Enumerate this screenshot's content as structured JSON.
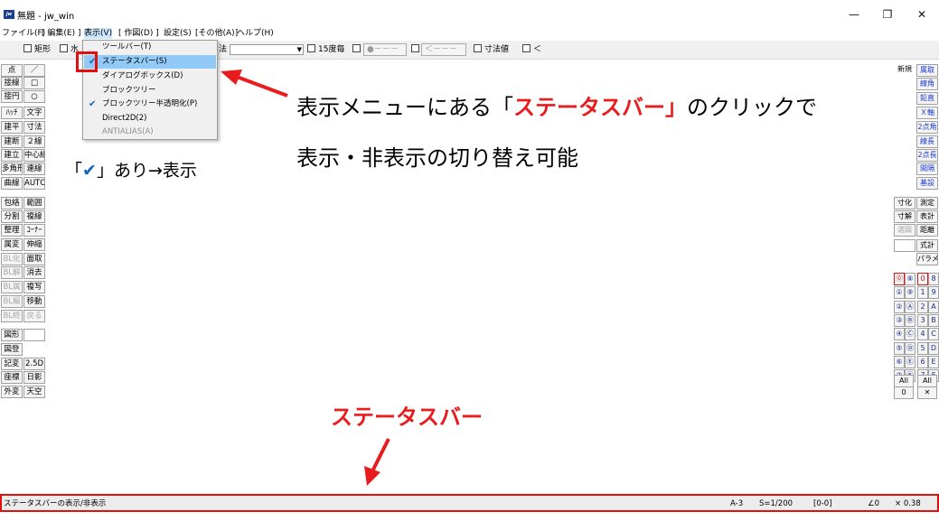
{
  "window": {
    "app_icon": "jw",
    "title": "無題 - jw_win",
    "minimize": "—",
    "maximize": "❐",
    "close": "✕"
  },
  "menu": {
    "items": [
      "ファイル(F)",
      "[ 編集(E) ]",
      "表示(V)",
      "[ 作図(D) ]",
      "設定(S)",
      "[その他(A)]",
      "ヘルプ(H)"
    ]
  },
  "toolbar": {
    "rect": "矩形",
    "horiz": "水",
    "dim_partial": "法",
    "angle15": "15度毎",
    "field1": "●－－－",
    "field2": "＜－－－",
    "dim_value": "寸法値",
    "last": "＜"
  },
  "dropdown": {
    "items": [
      {
        "label": "ツールバー(T)",
        "checked": false
      },
      {
        "label": "ステータスバー(S)",
        "checked": true
      },
      {
        "label": "ダイアログボックス(D)",
        "checked": false
      },
      {
        "label": "ブロックツリー",
        "checked": false
      },
      {
        "label": "ブロックツリー半透明化(P)",
        "checked": true
      },
      {
        "label": "Direct2D(2)",
        "checked": false
      },
      {
        "label": "ANTIALIAS(A)",
        "checked": false
      }
    ],
    "check_glyph": "✔"
  },
  "left_toolbar": [
    [
      "点",
      "／"
    ],
    [
      "接線",
      "□"
    ],
    [
      "接円",
      "○"
    ],
    [
      "ﾊｯﾁ",
      "文字"
    ],
    [
      "建平",
      "寸法"
    ],
    [
      "建断",
      "２線"
    ],
    [
      "建立",
      "中心線"
    ],
    [
      "多角形",
      "連線"
    ],
    [
      "曲線",
      "AUTO"
    ],
    [
      "包絡",
      "範囲"
    ],
    [
      "分割",
      "複線"
    ],
    [
      "整理",
      "ｺｰﾅｰ"
    ],
    [
      "属変",
      "伸縮"
    ],
    [
      "BL化",
      "面取"
    ],
    [
      "BL解",
      "消去"
    ],
    [
      "BL属",
      "複写"
    ],
    [
      "BL編",
      "移動"
    ],
    [
      "BL終",
      "戻る"
    ],
    [
      "図形",
      ""
    ],
    [
      "図登",
      ""
    ],
    [
      "記変",
      "2.5D"
    ],
    [
      "座標",
      "日影"
    ],
    [
      "外変",
      "天空"
    ]
  ],
  "right_toolbar": {
    "top": [
      [
        "新規",
        "属取"
      ],
      [
        "",
        "線角"
      ],
      [
        "",
        "鉛直"
      ],
      [
        "",
        "Ｘ軸"
      ],
      [
        "",
        "2点角"
      ],
      [
        "",
        "線長"
      ],
      [
        "",
        "2点長"
      ],
      [
        "",
        "間隔"
      ],
      [
        "",
        "基設"
      ]
    ],
    "middle": [
      [
        "寸化",
        "測定"
      ],
      [
        "寸解",
        "表計"
      ],
      [
        "選図",
        "距離"
      ],
      [
        "",
        "式計"
      ],
      [
        "",
        "パラメ"
      ]
    ],
    "layers_left": [
      "⓪",
      "①",
      "②",
      "③",
      "④",
      "⑤",
      "⑥",
      "⑦"
    ],
    "layers_left2": [
      "⑧",
      "⑨",
      "Ⓐ",
      "Ⓑ",
      "Ⓒ",
      "Ⓓ",
      "Ⓔ",
      "Ⓕ"
    ],
    "layers_right": [
      "0",
      "1",
      "2",
      "3",
      "4",
      "5",
      "6",
      "7"
    ],
    "layers_right2": [
      "8",
      "9",
      "A",
      "B",
      "C",
      "D",
      "E",
      "F"
    ],
    "all_left": "All",
    "all_right": "All",
    "zero": "0",
    "cross": "✕"
  },
  "annotations": {
    "line1_before": "表示メニューにある「",
    "line1_red": "ステータスバー」",
    "line1_after": "のクリックで",
    "line2": "表示・非表示の切り替え可能",
    "check_note_open": "「",
    "check_note_mark": "✔",
    "check_note_rest": "」あり→表示",
    "statusbar_label": "ステータスバー"
  },
  "statusbar": {
    "message": "ステータスバーの表示/非表示",
    "paper": "A-3",
    "scale": "S=1/200",
    "layer": "[0-0]",
    "angle": "∠0",
    "zoom": "× 0.38"
  },
  "colors": {
    "accent_red": "#e81c1c",
    "highlight": "#91c9f7",
    "check_blue": "#1565c0"
  }
}
